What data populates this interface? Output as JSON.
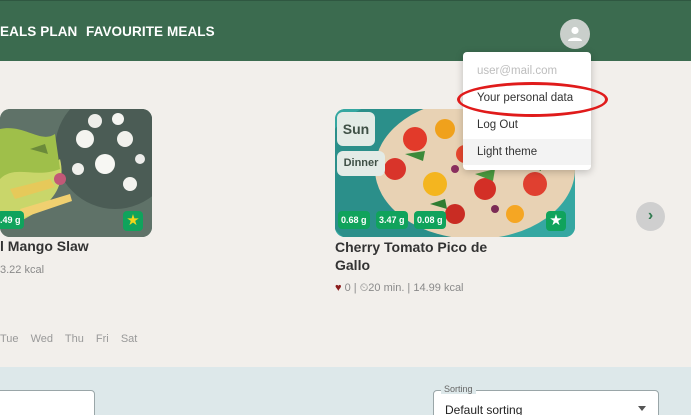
{
  "topbar": {
    "nav": [
      "EALS PLAN",
      "FAVOURITE MEALS"
    ],
    "avatar_icon": "account-circle-icon"
  },
  "user_menu": {
    "email": "user@mail.com",
    "items": [
      "Your personal data",
      "Log Out",
      "Light theme"
    ]
  },
  "cards": [
    {
      "title": "l Mango Slaw",
      "macros": [
        ".49 g"
      ],
      "meta": "3.22 kcal",
      "favourite_icon": "star-icon"
    },
    {
      "day": "Sun",
      "meal": "Dinner",
      "title": "Cherry Tomato Pico de Gallo",
      "macros": [
        "0.68 g",
        "3.47 g",
        "0.08 g"
      ],
      "likes": "0",
      "time": "20 min.",
      "kcal": "14.99 kcal",
      "favourite_icon": "star-icon"
    }
  ],
  "carousel": {
    "next_icon": "chevron-right-icon"
  },
  "days": [
    "Tue",
    "Wed",
    "Thu",
    "Fri",
    "Sat"
  ],
  "filters": {
    "sort_label": "Sorting",
    "sort_value": "Default sorting"
  },
  "colors": {
    "header": "#3b6b4f",
    "accent": "#10a35c",
    "highlight_ring": "#e01b1b"
  }
}
